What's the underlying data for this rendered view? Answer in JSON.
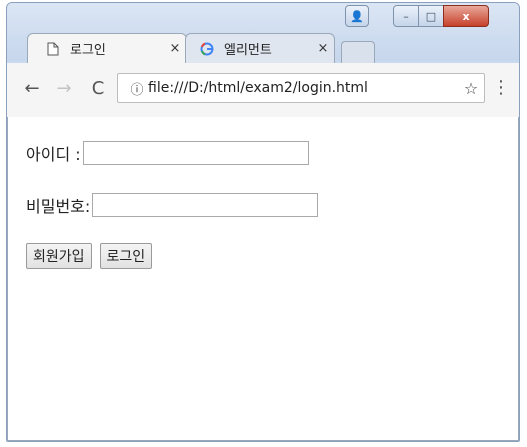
{
  "browser": {
    "tabs": [
      {
        "label": "로그인",
        "icon": "page-icon",
        "close": "×"
      },
      {
        "label": "엘리먼트",
        "icon": "google-icon",
        "close": "×"
      }
    ],
    "window_controls": {
      "user": "👤",
      "minimize": "–",
      "maximize": "□",
      "close": "x"
    },
    "nav": {
      "back": "←",
      "forward": "→",
      "reload": "C"
    },
    "address": {
      "info": "ⓘ",
      "url": "file:///D:/html/exam2/login.html",
      "star": "☆"
    },
    "menu": "⋮"
  },
  "page": {
    "id_label": "아이디 :",
    "id_value": "",
    "pw_label": "비밀번호:",
    "pw_value": "",
    "signup_button": "회원가입",
    "login_button": "로그인"
  },
  "colors": {
    "titlebar": "#c9d9ee",
    "close_button": "#c7412b",
    "google_g": "#4285f4"
  }
}
